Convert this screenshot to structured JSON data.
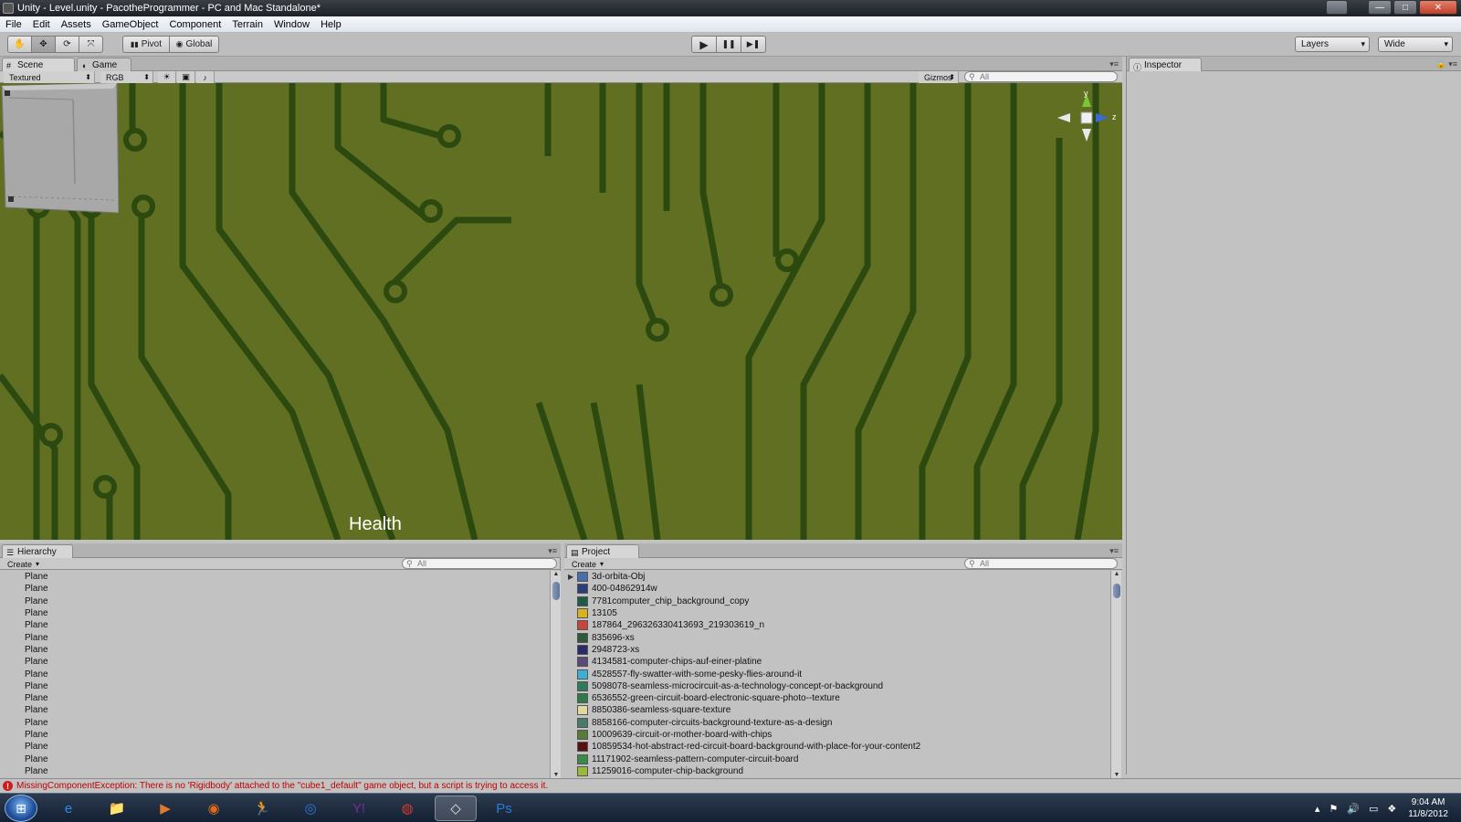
{
  "window": {
    "title": "Unity - Level.unity - PacotheProgrammer - PC and Mac Standalone*",
    "minimize": "—",
    "maximize": "□",
    "close": "✕"
  },
  "menu": [
    "File",
    "Edit",
    "Assets",
    "GameObject",
    "Component",
    "Terrain",
    "Window",
    "Help"
  ],
  "toolbar": {
    "tools": [
      "✋",
      "✥",
      "⟳",
      "⤧"
    ],
    "pivot": "Pivot",
    "global": "Global",
    "play": "▶",
    "pause": "❚❚",
    "step": "▶❚",
    "layers": "Layers",
    "layout": "Wide"
  },
  "tabs": {
    "scene": "Scene",
    "game": "Game",
    "inspector": "Inspector",
    "hierarchy": "Hierarchy",
    "project": "Project"
  },
  "scene_bar": {
    "render_mode": "Textured",
    "color_mode": "RGB",
    "gizmos": "Gizmos",
    "search_placeholder": "All"
  },
  "scene": {
    "health_label": "Health",
    "gizmo_y": "y",
    "gizmo_z": "z"
  },
  "hierarchy": {
    "create": "Create",
    "search_placeholder": "All",
    "items": [
      "Plane",
      "Plane",
      "Plane",
      "Plane",
      "Plane",
      "Plane",
      "Plane",
      "Plane",
      "Plane",
      "Plane",
      "Plane",
      "Plane",
      "Plane",
      "Plane",
      "Plane",
      "Plane",
      "Plane"
    ]
  },
  "project": {
    "create": "Create",
    "search_placeholder": "All",
    "items": [
      {
        "name": "3d-orbita-Obj",
        "color": "#4a6fa8"
      },
      {
        "name": "400-04862914w",
        "color": "#2a3f7a"
      },
      {
        "name": "7781computer_chip_background_copy",
        "color": "#1f5a45"
      },
      {
        "name": "13105",
        "color": "#d9b21c"
      },
      {
        "name": "187864_296326330413693_219303619_n",
        "color": "#c8443a"
      },
      {
        "name": "835696-xs",
        "color": "#2f5a3a"
      },
      {
        "name": "2948723-xs",
        "color": "#2a2a6a"
      },
      {
        "name": "4134581-computer-chips-auf-einer-platine",
        "color": "#5a4a7a"
      },
      {
        "name": "4528557-fly-swatter-with-some-pesky-flies-around-it",
        "color": "#3ab0d8"
      },
      {
        "name": "5098078-seamless-microcircuit-as-a-technology-concept-or-background",
        "color": "#2f7a5a"
      },
      {
        "name": "6536552-green-circuit-board-electronic-square-photo--texture",
        "color": "#2f7a45"
      },
      {
        "name": "8850386-seamless-square-texture",
        "color": "#e0d8a0"
      },
      {
        "name": "8858166-computer-circuits-background-texture-as-a-design",
        "color": "#4a7a6a"
      },
      {
        "name": "10009639-circuit-or-mother-board-with-chips",
        "color": "#5a7a3a"
      },
      {
        "name": "10859534-hot-abstract-red-circuit-board-background-with-place-for-your-content2",
        "color": "#5a1010"
      },
      {
        "name": "11171902-seamless-pattern-computer-circuit-board",
        "color": "#3a8a4a"
      },
      {
        "name": "11259016-computer-chip-background",
        "color": "#9ab83a"
      }
    ]
  },
  "status": {
    "message": "MissingComponentException: There is no 'Rigidbody' attached to the \"cube1_default\" game object, but a script is trying to access it."
  },
  "taskbar": {
    "start": "⊞",
    "apps": [
      {
        "icon": "e",
        "name": "internet-explorer",
        "color": "#2e8ae6"
      },
      {
        "icon": "📁",
        "name": "file-explorer",
        "color": "#e8c25a"
      },
      {
        "icon": "▶",
        "name": "media-player",
        "color": "#e07a2a"
      },
      {
        "icon": "◉",
        "name": "firefox",
        "color": "#e06a1a"
      },
      {
        "icon": "🏃",
        "name": "aim",
        "color": "#f0d020"
      },
      {
        "icon": "◎",
        "name": "teamviewer",
        "color": "#2a7ad8"
      },
      {
        "icon": "Y!",
        "name": "yahoo-messenger",
        "color": "#7a2a9a"
      },
      {
        "icon": "◍",
        "name": "chrome",
        "color": "#d83a2a"
      },
      {
        "icon": "◇",
        "name": "unity",
        "color": "#e0e0e0"
      },
      {
        "icon": "Ps",
        "name": "photoshop",
        "color": "#2a7ad8"
      }
    ],
    "time": "9:04 AM",
    "date": "11/8/2012"
  }
}
